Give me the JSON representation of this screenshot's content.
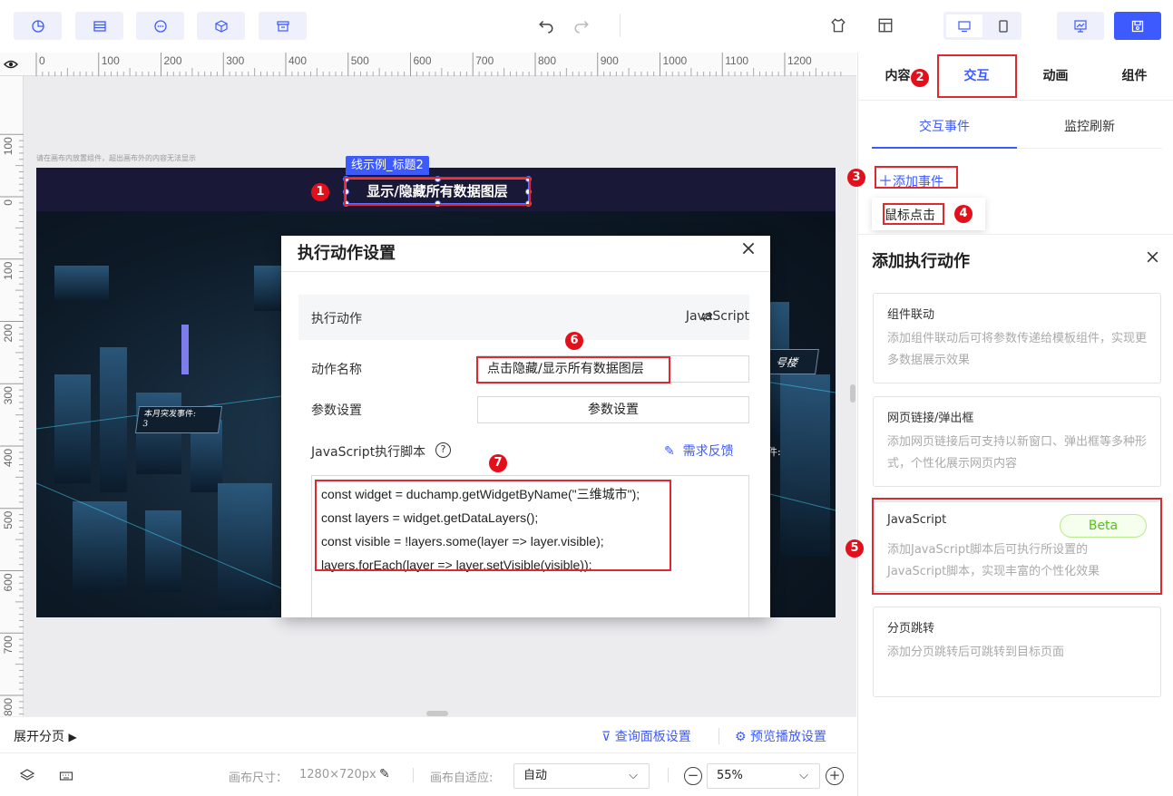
{
  "toolbar": {
    "left_buttons": [
      "chart-icon",
      "table-icon",
      "more-icon",
      "cube-icon",
      "archive-icon"
    ],
    "undo_icon": "undo-icon",
    "redo_icon": "redo-icon",
    "right_icons": [
      "theme-icon",
      "template-icon",
      "desktop-icon",
      "mobile-icon",
      "preview-icon",
      "save-icon"
    ]
  },
  "ruler": {
    "top_marks": [
      "0",
      "100",
      "200",
      "300",
      "400",
      "500",
      "600",
      "700",
      "800",
      "900",
      "1000",
      "1100",
      "1200"
    ],
    "left_marks": [
      "100",
      "0",
      "100",
      "200",
      "300",
      "400",
      "500",
      "600",
      "700",
      "800"
    ]
  },
  "canvas": {
    "hint": "请在画布内放置组件，超出画布外的内容无法显示",
    "selected_label": "线示例_标题2",
    "title_text": "显示/隐藏所有数据图层",
    "scene_tag1_title": "本月突发事件:",
    "scene_tag1_value": "3",
    "scene_tag2": "号楼",
    "scene_tag3": "件:"
  },
  "modal": {
    "title": "执行动作设置",
    "close_icon": "close-icon",
    "action_label": "执行动作",
    "action_value": "JavaScript",
    "name_label": "动作名称",
    "name_value": "点击隐藏/显示所有数据图层",
    "param_label": "参数设置",
    "param_button": "参数设置",
    "script_label": "JavaScript执行脚本",
    "feedback_link": "需求反馈",
    "script_lines": [
      "const widget = duchamp.getWidgetByName(\"三维城市\");",
      "const layers = widget.getDataLayers();",
      "const visible = !layers.some(layer => layer.visible);",
      "layers.forEach(layer => layer.setVisible(visible));"
    ]
  },
  "right_panel": {
    "tabs": [
      "内容",
      "交互",
      "动画",
      "组件"
    ],
    "active_tab": "交互",
    "subtabs": [
      "交互事件",
      "监控刷新"
    ],
    "add_event": "添加事件",
    "event_item": "鼠标点击",
    "add_action_title": "添加执行动作",
    "cards": [
      {
        "title": "组件联动",
        "desc": "添加组件联动后可将参数传递给模板组件，实现更多数据展示效果"
      },
      {
        "title": "网页链接/弹出框",
        "desc": "添加网页链接后可支持以新窗口、弹出框等多种形式，个性化展示网页内容"
      },
      {
        "title": "JavaScript",
        "badge": "Beta",
        "desc": "添加JavaScript脚本后可执行所设置的JavaScript脚本，实现丰富的个性化效果"
      },
      {
        "title": "分页跳转",
        "desc": "添加分页跳转后可跳转到目标页面"
      }
    ]
  },
  "callouts": [
    "1",
    "2",
    "3",
    "4",
    "5",
    "6",
    "7"
  ],
  "bottom": {
    "expand_pages": "展开分页",
    "query_panel": "查询面板设置",
    "preview_settings": "预览播放设置",
    "canvas_size_label": "画布尺寸：",
    "canvas_size_value": "1280×720px",
    "adapt_label": "画布自适应:",
    "adapt_value": "自动",
    "zoom_value": "55%"
  },
  "colors": {
    "accent": "#3d5afe",
    "callout_red": "#e3101b",
    "beta_green": "#52c41a",
    "stage_bg": "#0d1a27"
  }
}
